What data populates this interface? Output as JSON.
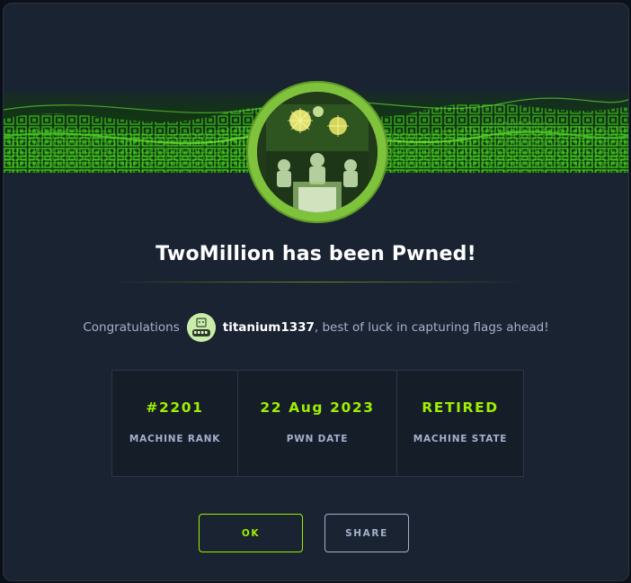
{
  "modal": {
    "title": "TwoMillion has been Pwned!",
    "congrats_prefix": "Congratulations",
    "username": "titanium1337",
    "congrats_suffix": ", best of luck in capturing flags ahead!"
  },
  "stats": [
    {
      "value": "#2201",
      "label": "MACHINE RANK"
    },
    {
      "value": "22 Aug 2023",
      "label": "PWN DATE"
    },
    {
      "value": "RETIRED",
      "label": "MACHINE STATE"
    }
  ],
  "buttons": {
    "ok_label": "OK",
    "share_label": "SHARE"
  },
  "colors": {
    "accent": "#9fef00",
    "background": "#1a2332",
    "muted_text": "#a4b1cd"
  },
  "icons": {
    "machine_avatar": "machine-avatar-icon",
    "user_avatar": "user-avatar-icon"
  }
}
